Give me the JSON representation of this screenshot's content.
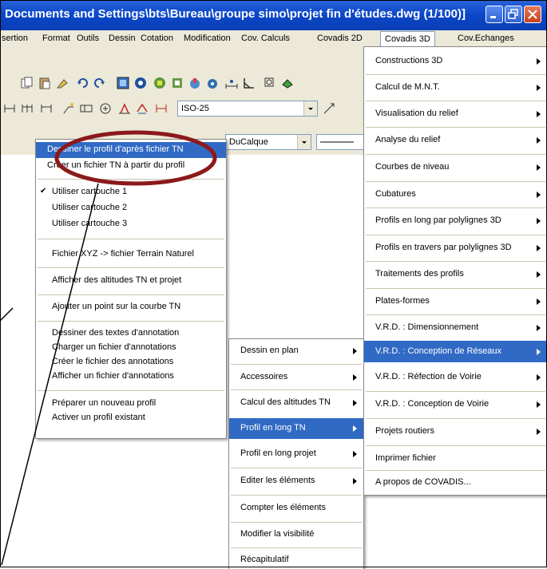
{
  "window": {
    "title": "Documents and Settings\\bts\\Bureau\\groupe simo\\projet fin d'études.dwg (1/100)]"
  },
  "menubar": {
    "items": [
      "sertion",
      "Format",
      "Outils",
      "Dessin",
      "Cotation",
      "Modification",
      "Cov. Calculs",
      "Covadis 2D",
      "Covadis 3D",
      "Cov.Echanges"
    ]
  },
  "toolbar": {
    "dimstyle_value": "ISO-25",
    "layer_value": "DuCalque"
  },
  "covadis3d_menu": {
    "items": [
      {
        "label": "Constructions 3D",
        "submenu": true
      },
      {
        "label": "Calcul de M.N.T.",
        "submenu": true
      },
      {
        "label": "Visualisation du relief",
        "submenu": true
      },
      {
        "label": "Analyse du relief",
        "submenu": true
      },
      {
        "label": "Courbes de niveau",
        "submenu": true
      },
      {
        "label": "Cubatures",
        "submenu": true
      },
      {
        "label": "Profils en long par polylignes 3D",
        "submenu": true
      },
      {
        "label": "Profils en travers par polylignes 3D",
        "submenu": true
      },
      {
        "label": "Traitements des profils",
        "submenu": true
      },
      {
        "label": "Plates-formes",
        "submenu": true
      },
      {
        "label": "V.R.D. : Dimensionnement",
        "submenu": true
      },
      {
        "label": "V.R.D. : Conception de Réseaux",
        "submenu": true,
        "highlighted": true
      },
      {
        "label": "V.R.D. : Réfection de Voirie",
        "submenu": true
      },
      {
        "label": "V.R.D. : Conception de Voirie",
        "submenu": true
      },
      {
        "label": "Projets routiers",
        "submenu": true
      },
      {
        "label": "Imprimer fichier",
        "submenu": false
      },
      {
        "label": "A propos de COVADIS...",
        "submenu": false
      }
    ]
  },
  "reseaux_menu": {
    "items": [
      {
        "label": "Dessin en plan",
        "submenu": true
      },
      {
        "label": "Accessoires",
        "submenu": true
      },
      {
        "label": "Calcul des altitudes TN",
        "submenu": true
      },
      {
        "label": "Profil en long  TN",
        "submenu": true,
        "highlighted": true
      },
      {
        "label": "Profil en long projet",
        "submenu": true
      },
      {
        "label": "Editer les éléments",
        "submenu": true
      },
      {
        "label": "Compter les éléments",
        "submenu": false
      },
      {
        "label": "Modifier la visibilité",
        "submenu": false
      },
      {
        "label": "Récapitulatif",
        "submenu": false
      }
    ]
  },
  "profil_menu": {
    "items": [
      {
        "label": "Dessiner le profil d'après fichier TN",
        "highlighted": true
      },
      {
        "label": "Créer un fichier TN à partir du profil"
      },
      {
        "label": "Utiliser cartouche 1",
        "checked": true
      },
      {
        "label": "Utiliser cartouche 2"
      },
      {
        "label": "Utiliser cartouche 3"
      },
      {
        "label": "Fichier XYZ -> fichier Terrain Naturel"
      },
      {
        "label": "Afficher des altitudes TN et projet"
      },
      {
        "label": "Ajouter un point sur la courbe TN"
      },
      {
        "label": "Dessiner des textes d'annotation"
      },
      {
        "label": "Charger un fichier d'annotations"
      },
      {
        "label": "Créer le fichier des annotations"
      },
      {
        "label": "Afficher un fichier d'annotations"
      },
      {
        "label": "Préparer un nouveau profil"
      },
      {
        "label": "Activer un profil existant"
      }
    ]
  },
  "colors": {
    "titlebar": "#0a46c8",
    "highlight": "#316ac5",
    "annotation_ellipse": "#8b1a1a"
  }
}
